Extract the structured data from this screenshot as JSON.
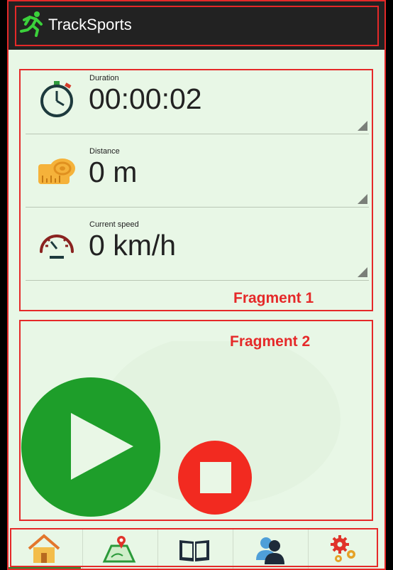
{
  "app": {
    "title": "TrackSports"
  },
  "metrics": [
    {
      "label": "Duration",
      "value": "00:00:02",
      "icon": "stopwatch-icon"
    },
    {
      "label": "Distance",
      "value": "0 m",
      "icon": "measuring-tape-icon"
    },
    {
      "label": "Current speed",
      "value": "0 km/h",
      "icon": "speedometer-icon"
    }
  ],
  "annotations": {
    "fragment1": "Fragment 1",
    "fragment2": "Fragment 2"
  },
  "controls": {
    "play": "play-icon",
    "stop": "stop-icon"
  },
  "nav": {
    "items": [
      {
        "icon": "home-icon"
      },
      {
        "icon": "map-route-icon"
      },
      {
        "icon": "book-icon"
      },
      {
        "icon": "users-icon"
      },
      {
        "icon": "settings-gears-icon"
      }
    ],
    "active_index": 0
  },
  "colors": {
    "appbar": "#222222",
    "background": "#e8f7e6",
    "play": "#1e9e2a",
    "stop": "#f22a20",
    "annotation": "#e52929"
  }
}
